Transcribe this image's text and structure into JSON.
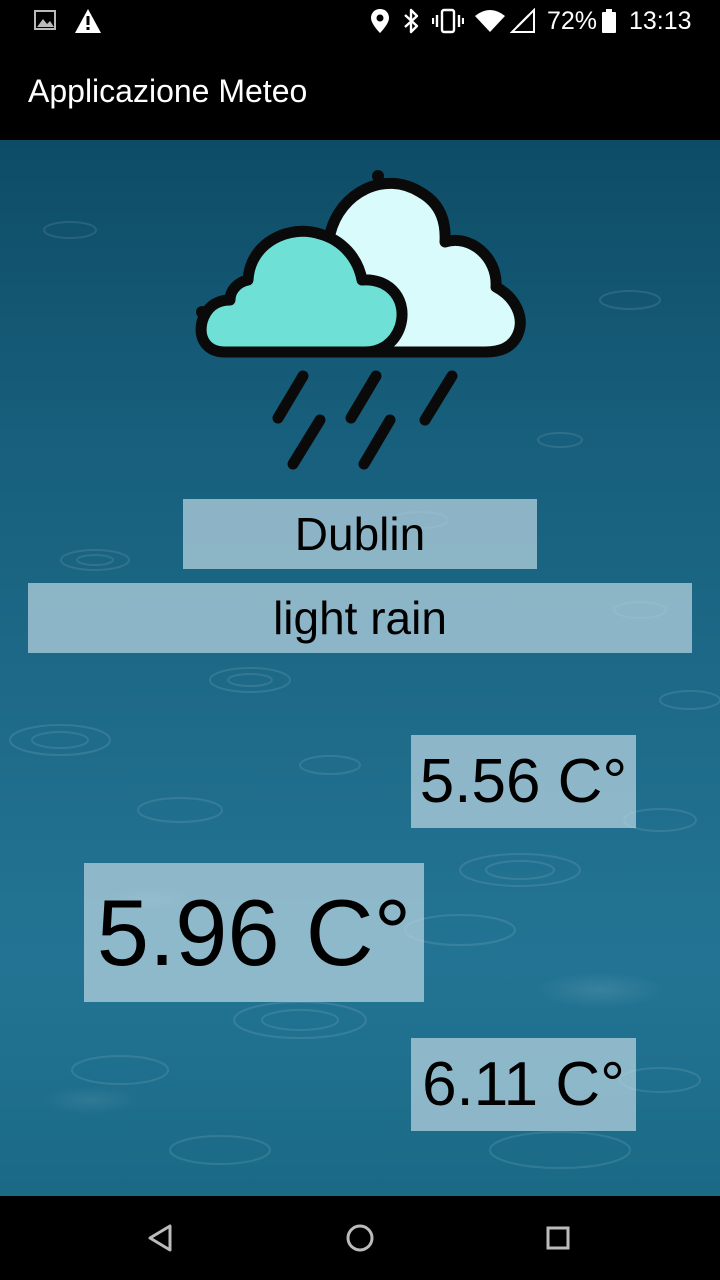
{
  "status_bar": {
    "icons": [
      "image-notification-icon",
      "warning-icon",
      "location-icon",
      "bluetooth-icon",
      "vibrate-icon",
      "wifi-icon",
      "signal-icon",
      "battery-icon"
    ],
    "battery_percent": "72%",
    "time": "13:13"
  },
  "app_bar": {
    "title": "Applicazione Meteo"
  },
  "weather": {
    "icon": "rain-cloud-icon",
    "city": "Dublin",
    "description": "light rain",
    "temp_min": "5.56 C°",
    "temp_current": "5.96 C°",
    "temp_max": "6.11 C°"
  },
  "nav_bar": {
    "buttons": [
      "back-icon",
      "home-icon",
      "recents-icon"
    ]
  },
  "colors": {
    "cloud_front": "#6ee0d6",
    "cloud_back": "#d9fbfb",
    "outline": "#0a0a0a",
    "label_bg": "#b9d4e0",
    "bars": "#000000"
  }
}
